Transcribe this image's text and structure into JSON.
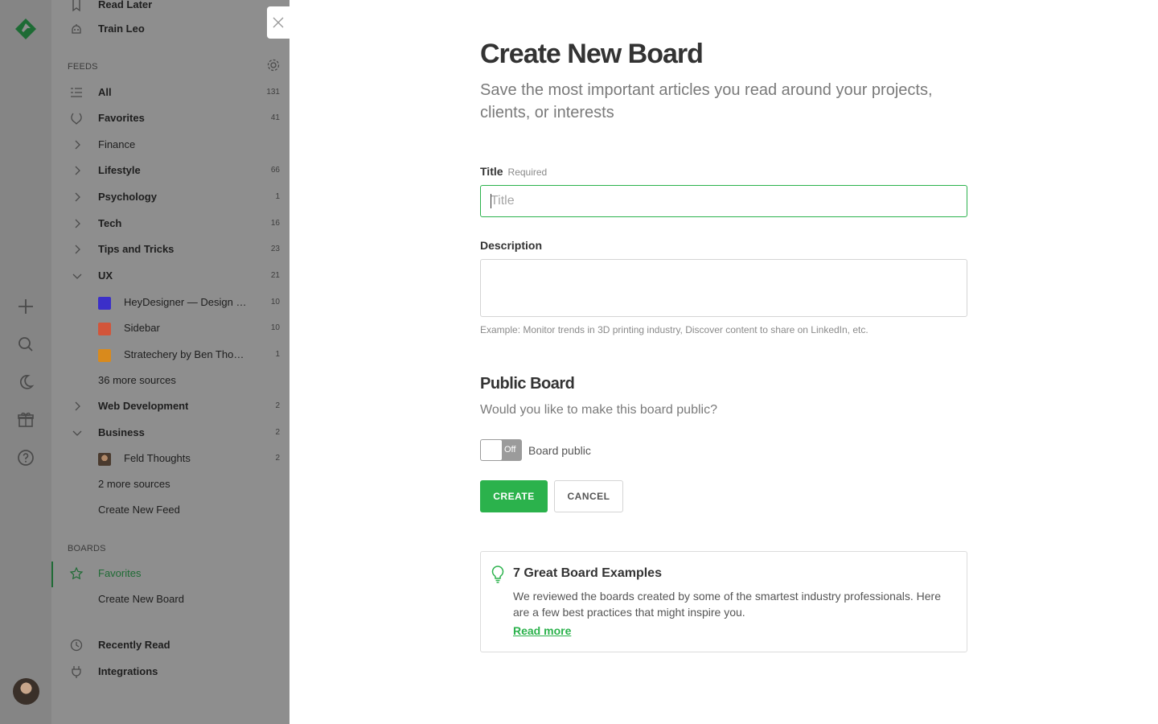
{
  "sidebar": {
    "top_items": [
      {
        "label": "Read Later",
        "icon": "bookmark-icon"
      },
      {
        "label": "Train Leo",
        "icon": "robot-icon"
      }
    ],
    "feeds_heading": "FEEDS",
    "feeds": [
      {
        "label": "All",
        "count": "131",
        "icon": "list-icon"
      },
      {
        "label": "Favorites",
        "count": "41",
        "icon": "laurel-icon"
      },
      {
        "label": "Finance",
        "count": ""
      },
      {
        "label": "Lifestyle",
        "count": "66"
      },
      {
        "label": "Psychology",
        "count": "1"
      },
      {
        "label": "Tech",
        "count": "16"
      },
      {
        "label": "Tips and Tricks",
        "count": "23"
      },
      {
        "label": "UX",
        "count": "21"
      },
      {
        "label": "HeyDesigner — Design …",
        "count": "10",
        "color": "#3b2fc9"
      },
      {
        "label": "Sidebar",
        "count": "10",
        "color": "#d2553a"
      },
      {
        "label": "Stratechery by Ben Tho…",
        "count": "1",
        "color": "#d98a1c"
      },
      {
        "label": "36 more sources"
      },
      {
        "label": "Web Development",
        "count": "2"
      },
      {
        "label": "Business",
        "count": "2"
      },
      {
        "label": "Feld Thoughts",
        "count": "2"
      },
      {
        "label": "2 more sources"
      },
      {
        "label": "Create New Feed"
      }
    ],
    "boards_heading": "BOARDS",
    "boards": [
      {
        "label": "Favorites",
        "active": true
      },
      {
        "label": "Create New Board"
      }
    ],
    "bottom_items": [
      {
        "label": "Recently Read",
        "icon": "clock-icon"
      },
      {
        "label": "Integrations",
        "icon": "plug-icon"
      }
    ]
  },
  "form": {
    "title": "Create New Board",
    "subtitle": "Save the most important articles you read around your projects, clients, or interests",
    "title_label": "Title",
    "title_required": "Required",
    "title_placeholder": "Title",
    "description_label": "Description",
    "description_hint": "Example: Monitor trends in 3D printing industry, Discover content to share on LinkedIn, etc.",
    "public_heading": "Public Board",
    "public_question": "Would you like to make this board public?",
    "toggle_state": "Off",
    "toggle_label": "Board public",
    "create_label": "CREATE",
    "cancel_label": "CANCEL"
  },
  "tip_card": {
    "title": "7 Great Board Examples",
    "body": "We reviewed the boards created by some of the smartest industry professionals. Here are a few best practices that might inspire you.",
    "link": "Read more"
  },
  "colors": {
    "accent": "#2bb24c",
    "overlay": "#8e8e8e"
  }
}
